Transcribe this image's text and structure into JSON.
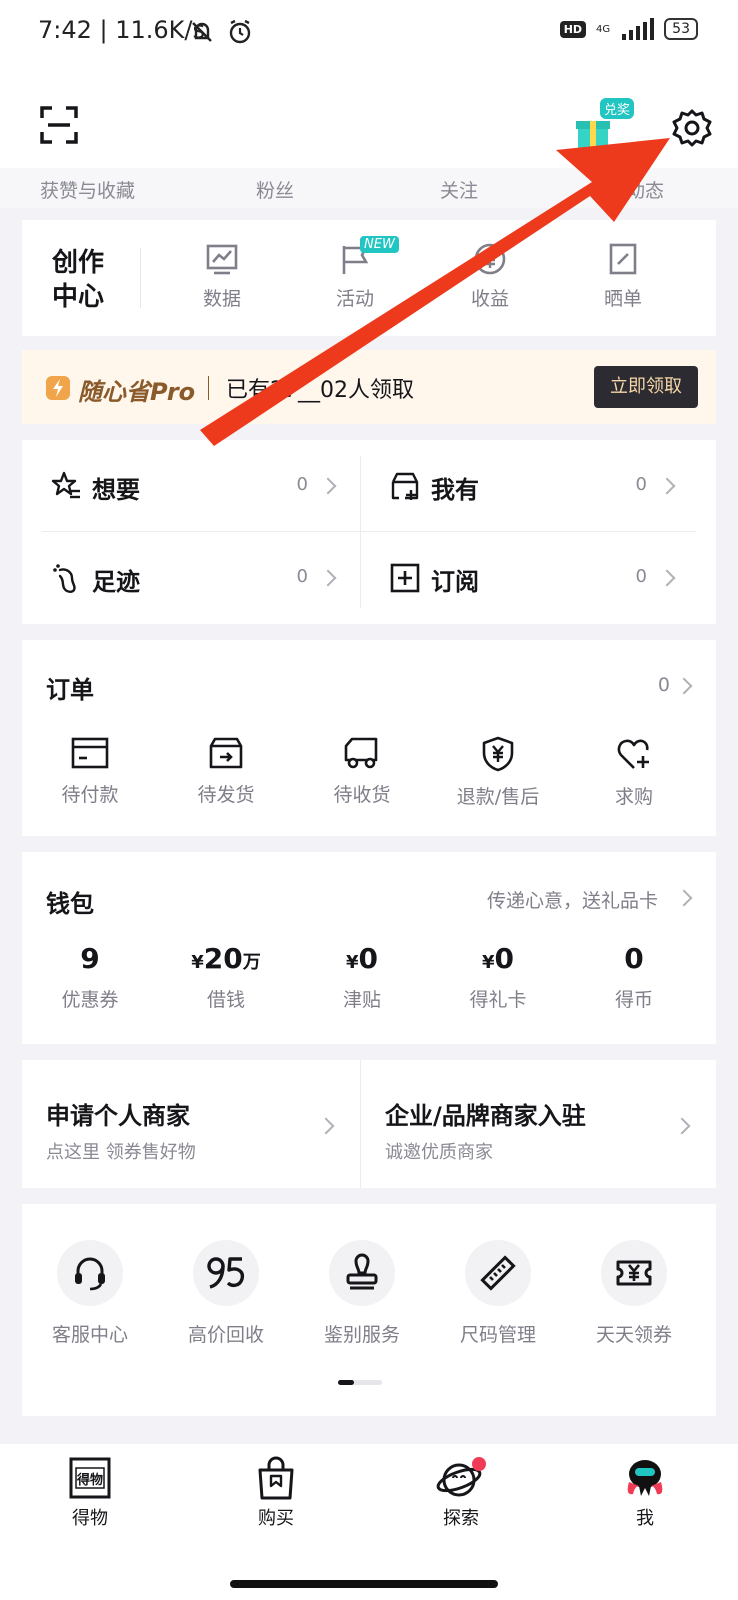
{
  "status_bar": {
    "time": "7:42 | 11.6K/s",
    "hd": "HD",
    "network": "4G",
    "battery": "53"
  },
  "header": {
    "redeem_badge": "兑奖",
    "stats": [
      "获赞与收藏",
      "粉丝",
      "关注",
      "动态"
    ]
  },
  "creator_center": {
    "title": "创作中心",
    "items": [
      "数据",
      "活动",
      "收益",
      "晒单"
    ],
    "new_badge": "NEW"
  },
  "promo": {
    "brand": "随心省Pro",
    "text": "已有27__02人领取",
    "button": "立即领取"
  },
  "quick_links": [
    {
      "label": "想要",
      "count": "0"
    },
    {
      "label": "我有",
      "count": "0"
    },
    {
      "label": "足迹",
      "count": "0"
    },
    {
      "label": "订阅",
      "count": "0"
    }
  ],
  "orders": {
    "title": "订单",
    "count": "0",
    "items": [
      "待付款",
      "待发货",
      "待收货",
      "退款/售后",
      "求购"
    ]
  },
  "wallet": {
    "title": "钱包",
    "link": "传递心意，送礼品卡",
    "items": [
      {
        "currency": "",
        "value": "9",
        "unit": "",
        "label": "优惠券"
      },
      {
        "currency": "¥",
        "value": "20",
        "unit": "万",
        "label": "借钱"
      },
      {
        "currency": "¥",
        "value": "0",
        "unit": "",
        "label": "津贴"
      },
      {
        "currency": "¥",
        "value": "0",
        "unit": "",
        "label": "得礼卡"
      },
      {
        "currency": "",
        "value": "0",
        "unit": "",
        "label": "得币"
      }
    ]
  },
  "merchant": {
    "personal_title": "申请个人商家",
    "personal_sub": "点这里 领券售好物",
    "brand_title": "企业/品牌商家入驻",
    "brand_sub": "诚邀优质商家"
  },
  "services": [
    "客服中心",
    "高价回收",
    "鉴别服务",
    "尺码管理",
    "天天领券"
  ],
  "tabbar": {
    "items": [
      "得物",
      "购买",
      "探索",
      "我"
    ],
    "logo_text": "得物"
  },
  "colors": {
    "accent_teal": "#21c5c2",
    "arrow_red": "#ee3a1c",
    "promo_gold": "#8a5a2a"
  }
}
